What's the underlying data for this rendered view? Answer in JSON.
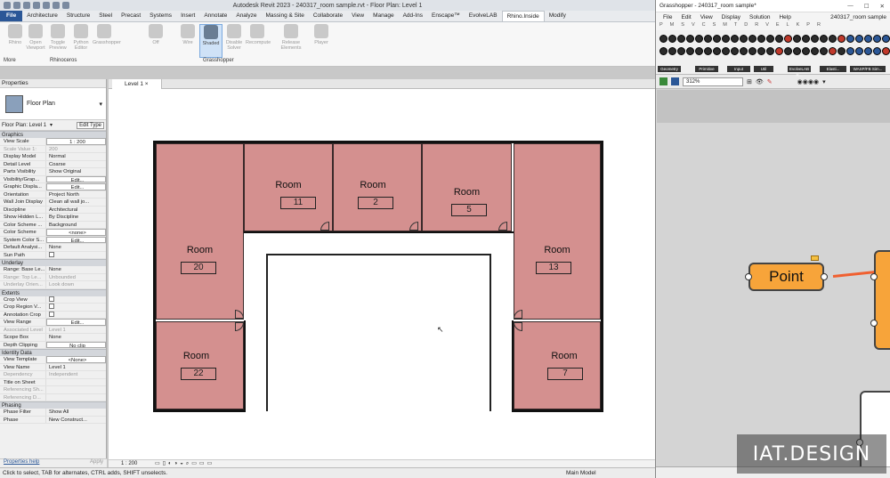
{
  "app": {
    "title": "Autodesk Revit 2023 - 240317_room sample.rvt - Floor Plan: Level 1"
  },
  "ribbon": {
    "tabs": [
      "File",
      "Architecture",
      "Structure",
      "Steel",
      "Precast",
      "Systems",
      "Insert",
      "Annotate",
      "Analyze",
      "Massing & Site",
      "Collaborate",
      "View",
      "Manage",
      "Add-Ins",
      "Enscape™",
      "EvolveLAB",
      "Rhino.Inside",
      "Modify"
    ],
    "active_tab": "Rhino.Inside",
    "buttons": [
      {
        "label": "Rhino"
      },
      {
        "label": "Open Viewport"
      },
      {
        "label": "Toggle Preview"
      },
      {
        "label": "Python Editor"
      },
      {
        "label": "Grasshopper"
      },
      {
        "label": "Off"
      },
      {
        "label": "Wire"
      },
      {
        "label": "Shaded"
      },
      {
        "label": "Disable Solver"
      },
      {
        "label": "Recompute"
      },
      {
        "label": "Release Elements"
      },
      {
        "label": "Player"
      }
    ],
    "groups": {
      "more": "More",
      "rhinoceros": "Rhinoceros",
      "grasshopper": "Grasshopper"
    }
  },
  "properties": {
    "header": "Properties",
    "type_name": "Floor Plan",
    "selector": "Floor Plan: Level 1",
    "edit_type": "Edit Type",
    "sections": [
      {
        "name": "Graphics",
        "rows": [
          {
            "k": "View Scale",
            "v": "1 : 200",
            "box": true
          },
          {
            "k": "Scale Value  1:",
            "v": "200",
            "dim": true
          },
          {
            "k": "Display Model",
            "v": "Normal"
          },
          {
            "k": "Detail Level",
            "v": "Coarse"
          },
          {
            "k": "Parts Visibility",
            "v": "Show Original"
          },
          {
            "k": "Visibility/Grap...",
            "v": "Edit...",
            "box": true
          },
          {
            "k": "Graphic Displa...",
            "v": "Edit...",
            "box": true
          },
          {
            "k": "Orientation",
            "v": "Project North"
          },
          {
            "k": "Wall Join Display",
            "v": "Clean all wall jo..."
          },
          {
            "k": "Discipline",
            "v": "Architectural"
          },
          {
            "k": "Show Hidden L...",
            "v": "By Discipline"
          },
          {
            "k": "Color Scheme ...",
            "v": "Background"
          },
          {
            "k": "Color Scheme",
            "v": "<none>",
            "box": true
          },
          {
            "k": "System Color S...",
            "v": "Edit...",
            "box": true
          },
          {
            "k": "Default Analysi...",
            "v": "None"
          },
          {
            "k": "Sun Path",
            "v": "",
            "cb": true
          }
        ]
      },
      {
        "name": "Underlay",
        "rows": [
          {
            "k": "Range: Base Le...",
            "v": "None"
          },
          {
            "k": "Range: Top Le...",
            "v": "Unbounded",
            "dim": true
          },
          {
            "k": "Underlay Orien...",
            "v": "Look down",
            "dim": true
          }
        ]
      },
      {
        "name": "Extents",
        "rows": [
          {
            "k": "Crop View",
            "v": "",
            "cb": true
          },
          {
            "k": "Crop Region V...",
            "v": "",
            "cb": true
          },
          {
            "k": "Annotation Crop",
            "v": "",
            "cb": true
          },
          {
            "k": "View Range",
            "v": "Edit...",
            "box": true
          },
          {
            "k": "Associated Level",
            "v": "Level 1",
            "dim": true
          },
          {
            "k": "Scope Box",
            "v": "None"
          },
          {
            "k": "Depth Clipping",
            "v": "No clip",
            "box": true
          }
        ]
      },
      {
        "name": "Identity Data",
        "rows": [
          {
            "k": "View Template",
            "v": "<None>",
            "box": true
          },
          {
            "k": "View Name",
            "v": "Level 1"
          },
          {
            "k": "Dependency",
            "v": "Independent",
            "dim": true
          },
          {
            "k": "Title on Sheet",
            "v": ""
          },
          {
            "k": "Referencing Sh...",
            "v": "",
            "dim": true
          },
          {
            "k": "Referencing D...",
            "v": "",
            "dim": true
          }
        ]
      },
      {
        "name": "Phasing",
        "rows": [
          {
            "k": "Phase Filter",
            "v": "Show All"
          },
          {
            "k": "Phase",
            "v": "New Construct..."
          }
        ]
      }
    ],
    "help_link": "Properties help",
    "apply": "Apply"
  },
  "view": {
    "tab": "Level 1",
    "scale": "1 : 200",
    "rooms": [
      {
        "name": "Room",
        "number": "20"
      },
      {
        "name": "Room",
        "number": "11"
      },
      {
        "name": "Room",
        "number": "2"
      },
      {
        "name": "Room",
        "number": "5"
      },
      {
        "name": "Room",
        "number": "13"
      },
      {
        "name": "Room",
        "number": "22"
      },
      {
        "name": "Room",
        "number": "7"
      }
    ]
  },
  "status": {
    "hint": "Click to select, TAB for alternates, CTRL adds, SHIFT unselects.",
    "model": "Main Model"
  },
  "grasshopper": {
    "title": "Grasshopper - 240317_room sample*",
    "file_name": "240317_room sample",
    "menu": [
      "File",
      "Edit",
      "View",
      "Display",
      "Solution",
      "Help"
    ],
    "categories": [
      "P",
      "M",
      "S",
      "V",
      "C",
      "S",
      "M",
      "T",
      "D",
      "R",
      "V",
      "E",
      "L",
      "K",
      "P",
      "R"
    ],
    "palette_groups": [
      "Geometry",
      "Primitive",
      "Input",
      "Util",
      "EvolveLAB R...",
      "Elasti...",
      "WASP/FB Sim..."
    ],
    "zoom": "312%",
    "node_label": "Point"
  },
  "watermark": {
    "text": "IAT.DESIGN"
  },
  "colors": {
    "room_fill": "#d4908f",
    "node": "#f7a43a",
    "wire": "#f06030",
    "accent": "#2b5797"
  }
}
